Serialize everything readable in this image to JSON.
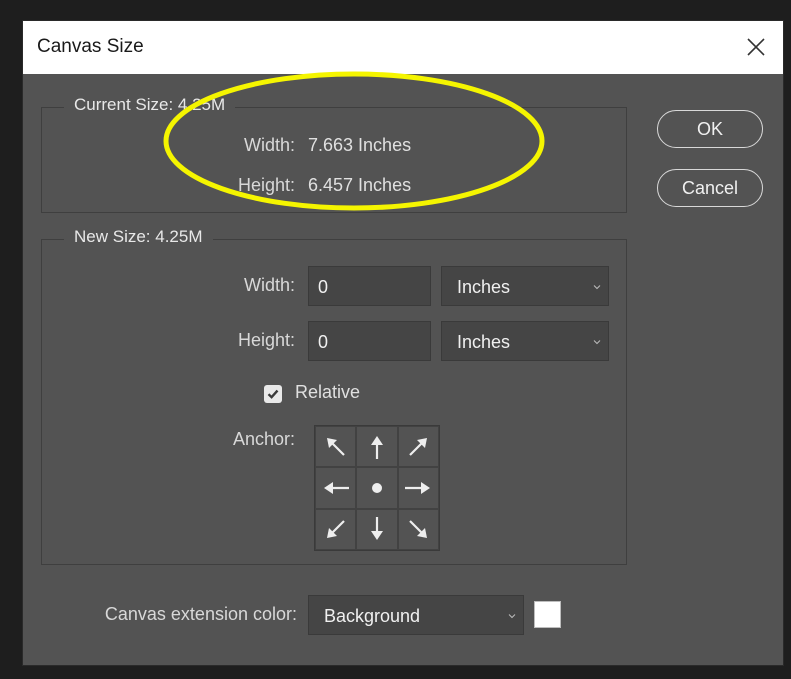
{
  "dialog": {
    "title": "Canvas Size",
    "ok_label": "OK",
    "cancel_label": "Cancel"
  },
  "current_size": {
    "legend": "Current Size: 4.25M",
    "width_label": "Width:",
    "width_value": "7.663 Inches",
    "height_label": "Height:",
    "height_value": "6.457 Inches"
  },
  "new_size": {
    "legend": "New Size: 4.25M",
    "width_label": "Width:",
    "width_value": "0",
    "width_unit": "Inches",
    "height_label": "Height:",
    "height_value": "0",
    "height_unit": "Inches",
    "relative_label": "Relative",
    "relative_checked": true,
    "anchor_label": "Anchor:",
    "anchor_icons": [
      "arrow-up-left-icon",
      "arrow-up-icon",
      "arrow-up-right-icon",
      "arrow-left-icon",
      "dot-icon",
      "arrow-right-icon",
      "arrow-down-left-icon",
      "arrow-down-icon",
      "arrow-down-right-icon"
    ]
  },
  "extension": {
    "label": "Canvas extension color:",
    "value": "Background",
    "swatch_color": "#ffffff"
  },
  "annotation": {
    "color": "#f5f500"
  }
}
